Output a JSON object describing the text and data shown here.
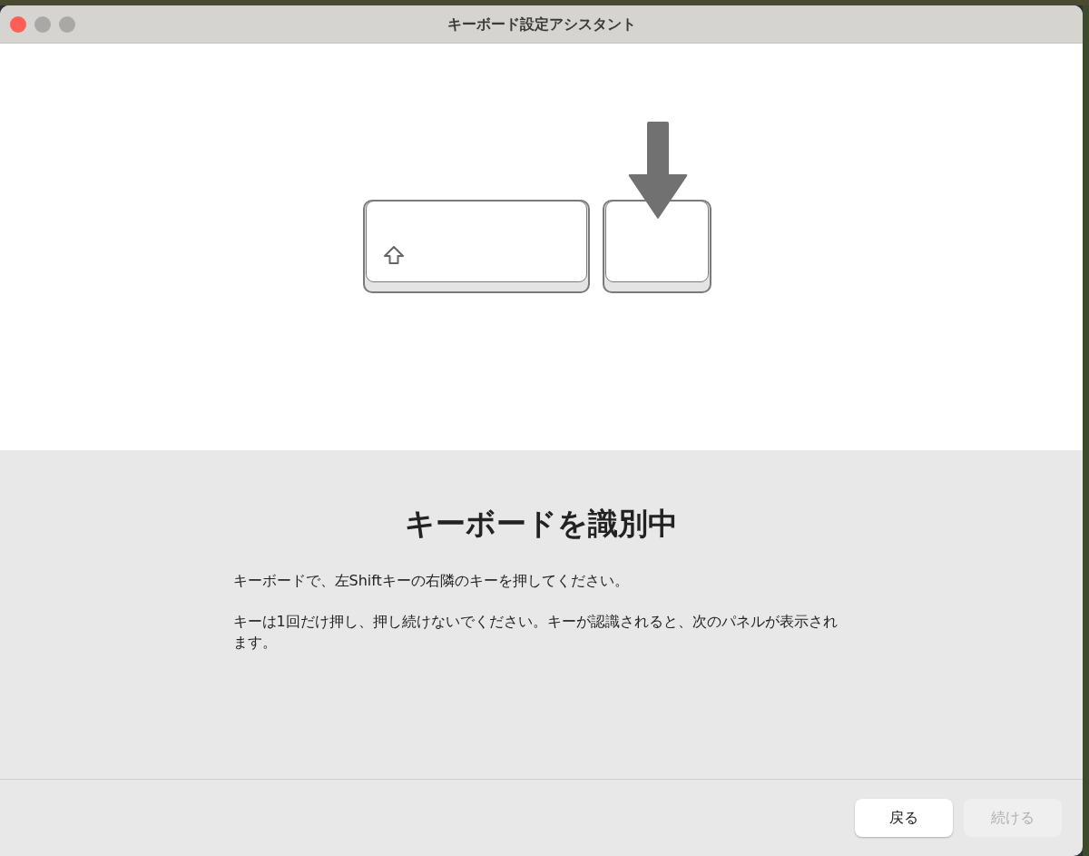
{
  "window": {
    "title": "キーボード設定アシスタント",
    "controls": [
      {
        "color": "#ff5f57"
      },
      {
        "color": "#a9a8a6"
      },
      {
        "color": "#a9a8a6"
      }
    ]
  },
  "illustration": {
    "keys": [
      {
        "kind": "shift"
      },
      {
        "kind": "target"
      }
    ]
  },
  "heading": "キーボードを識別中",
  "paragraphs": [
    "キーボードで、左Shiftキーの右隣のキーを押してください。",
    "キーは1回だけ押し、押し続けないでください。キーが認識されると、次のパネルが表示されます。"
  ],
  "buttons": [
    {
      "label": "戻る",
      "disabled": false
    },
    {
      "label": "続ける",
      "disabled": true
    }
  ]
}
